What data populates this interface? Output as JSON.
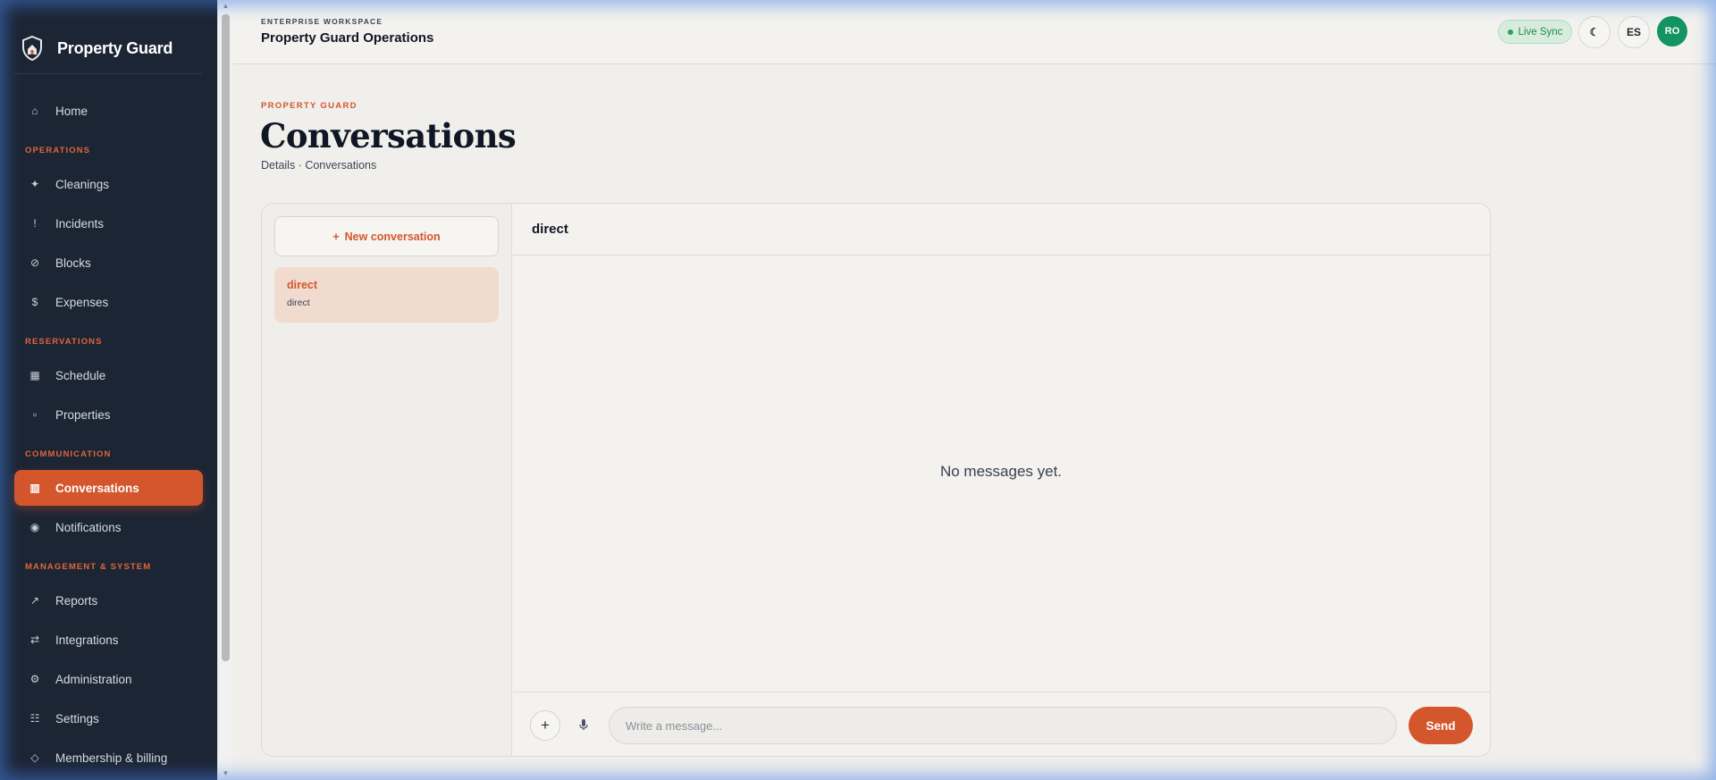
{
  "brand": {
    "name": "Property Guard"
  },
  "sidebar": {
    "items": [
      {
        "label": "Home",
        "icon": "⌂"
      },
      {
        "section": "OPERATIONS"
      },
      {
        "label": "Cleanings",
        "icon": "✦"
      },
      {
        "label": "Incidents",
        "icon": "!"
      },
      {
        "label": "Blocks",
        "icon": "⊘"
      },
      {
        "label": "Expenses",
        "icon": "$"
      },
      {
        "section": "RESERVATIONS"
      },
      {
        "label": "Schedule",
        "icon": "▦"
      },
      {
        "label": "Properties",
        "icon": "▫"
      },
      {
        "section": "COMMUNICATION"
      },
      {
        "label": "Conversations",
        "icon": "▥",
        "active": true
      },
      {
        "label": "Notifications",
        "icon": "◉"
      },
      {
        "section": "MANAGEMENT & SYSTEM"
      },
      {
        "label": "Reports",
        "icon": "↗"
      },
      {
        "label": "Integrations",
        "icon": "⇄"
      },
      {
        "label": "Administration",
        "icon": "⚙"
      },
      {
        "label": "Settings",
        "icon": "☷"
      },
      {
        "label": "Membership & billing",
        "icon": "◇"
      }
    ]
  },
  "header": {
    "kicker": "ENTERPRISE WORKSPACE",
    "title": "Property Guard Operations",
    "live_sync": "Live Sync",
    "theme_icon": "☾",
    "lang": "ES",
    "avatar": "RO"
  },
  "page": {
    "kicker": "PROPERTY GUARD",
    "title": "Conversations",
    "breadcrumb": "Details · Conversations"
  },
  "conversations": {
    "new_label": "New conversation",
    "new_icon": "+",
    "items": [
      {
        "title": "direct",
        "subtitle": "direct"
      }
    ]
  },
  "thread": {
    "title": "direct",
    "empty": "No messages yet.",
    "attach_icon": "+",
    "mic_icon": "🎙",
    "input_placeholder": "Write a message...",
    "send_label": "Send"
  },
  "colors": {
    "accent": "#d4562c",
    "sidebar_bg": "#1c2534",
    "live": "#1f8a4c",
    "avatar": "#139461"
  }
}
